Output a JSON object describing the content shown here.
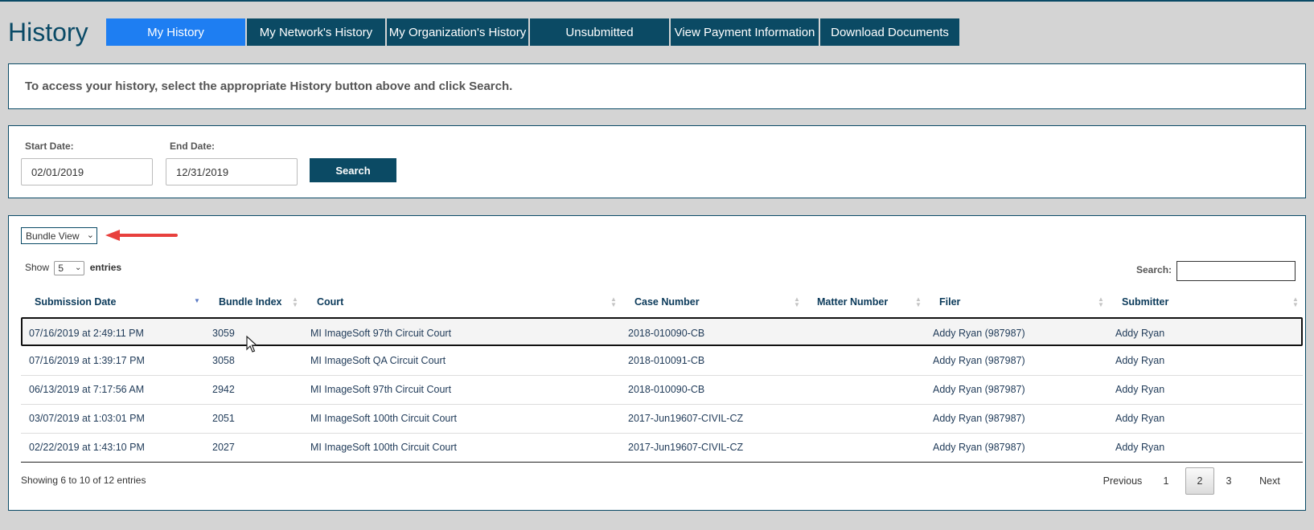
{
  "header": {
    "title": "History",
    "tabs": [
      {
        "label": "My History",
        "active": true
      },
      {
        "label": "My Network's History",
        "active": false
      },
      {
        "label": "My Organization's History",
        "active": false
      },
      {
        "label": "Unsubmitted",
        "active": false
      },
      {
        "label": "View Payment Information",
        "active": false
      },
      {
        "label": "Download Documents",
        "active": false
      }
    ]
  },
  "info": {
    "message": "To access your history, select the appropriate History button above and click Search."
  },
  "search_form": {
    "start_label": "Start Date:",
    "start_value": "02/01/2019",
    "end_label": "End Date:",
    "end_value": "12/31/2019",
    "search_button": "Search"
  },
  "results": {
    "view_select": "Bundle View",
    "show_label": "Show",
    "entries_value": "5",
    "entries_label": "entries",
    "search_label": "Search:",
    "search_value": "",
    "columns": [
      "Submission Date",
      "Bundle Index",
      "Court",
      "Case Number",
      "Matter Number",
      "Filer",
      "Submitter"
    ],
    "rows": [
      [
        "07/16/2019 at 2:49:11 PM",
        "3059",
        "MI ImageSoft 97th Circuit Court",
        "2018-010090-CB",
        "",
        "Addy Ryan (987987)",
        "Addy Ryan"
      ],
      [
        "07/16/2019 at 1:39:17 PM",
        "3058",
        "MI ImageSoft QA Circuit Court",
        "2018-010091-CB",
        "",
        "Addy Ryan (987987)",
        "Addy Ryan"
      ],
      [
        "06/13/2019 at 7:17:56 AM",
        "2942",
        "MI ImageSoft 97th Circuit Court",
        "2018-010090-CB",
        "",
        "Addy Ryan (987987)",
        "Addy Ryan"
      ],
      [
        "03/07/2019 at 1:03:01 PM",
        "2051",
        "MI ImageSoft 100th Circuit Court",
        "2017-Jun19607-CIVIL-CZ",
        "",
        "Addy Ryan (987987)",
        "Addy Ryan"
      ],
      [
        "02/22/2019 at 1:43:10 PM",
        "2027",
        "MI ImageSoft 100th Circuit Court",
        "2017-Jun19607-CIVIL-CZ",
        "",
        "Addy Ryan (987987)",
        "Addy Ryan"
      ]
    ],
    "summary": "Showing 6 to 10 of 12 entries",
    "pagination": {
      "previous": "Previous",
      "pages": [
        "1",
        "2",
        "3"
      ],
      "current_page": "2",
      "next": "Next"
    }
  },
  "colors": {
    "active_tab": "#1e7ef2",
    "tab": "#0b4a64",
    "accent_arrow": "#e8403d"
  }
}
